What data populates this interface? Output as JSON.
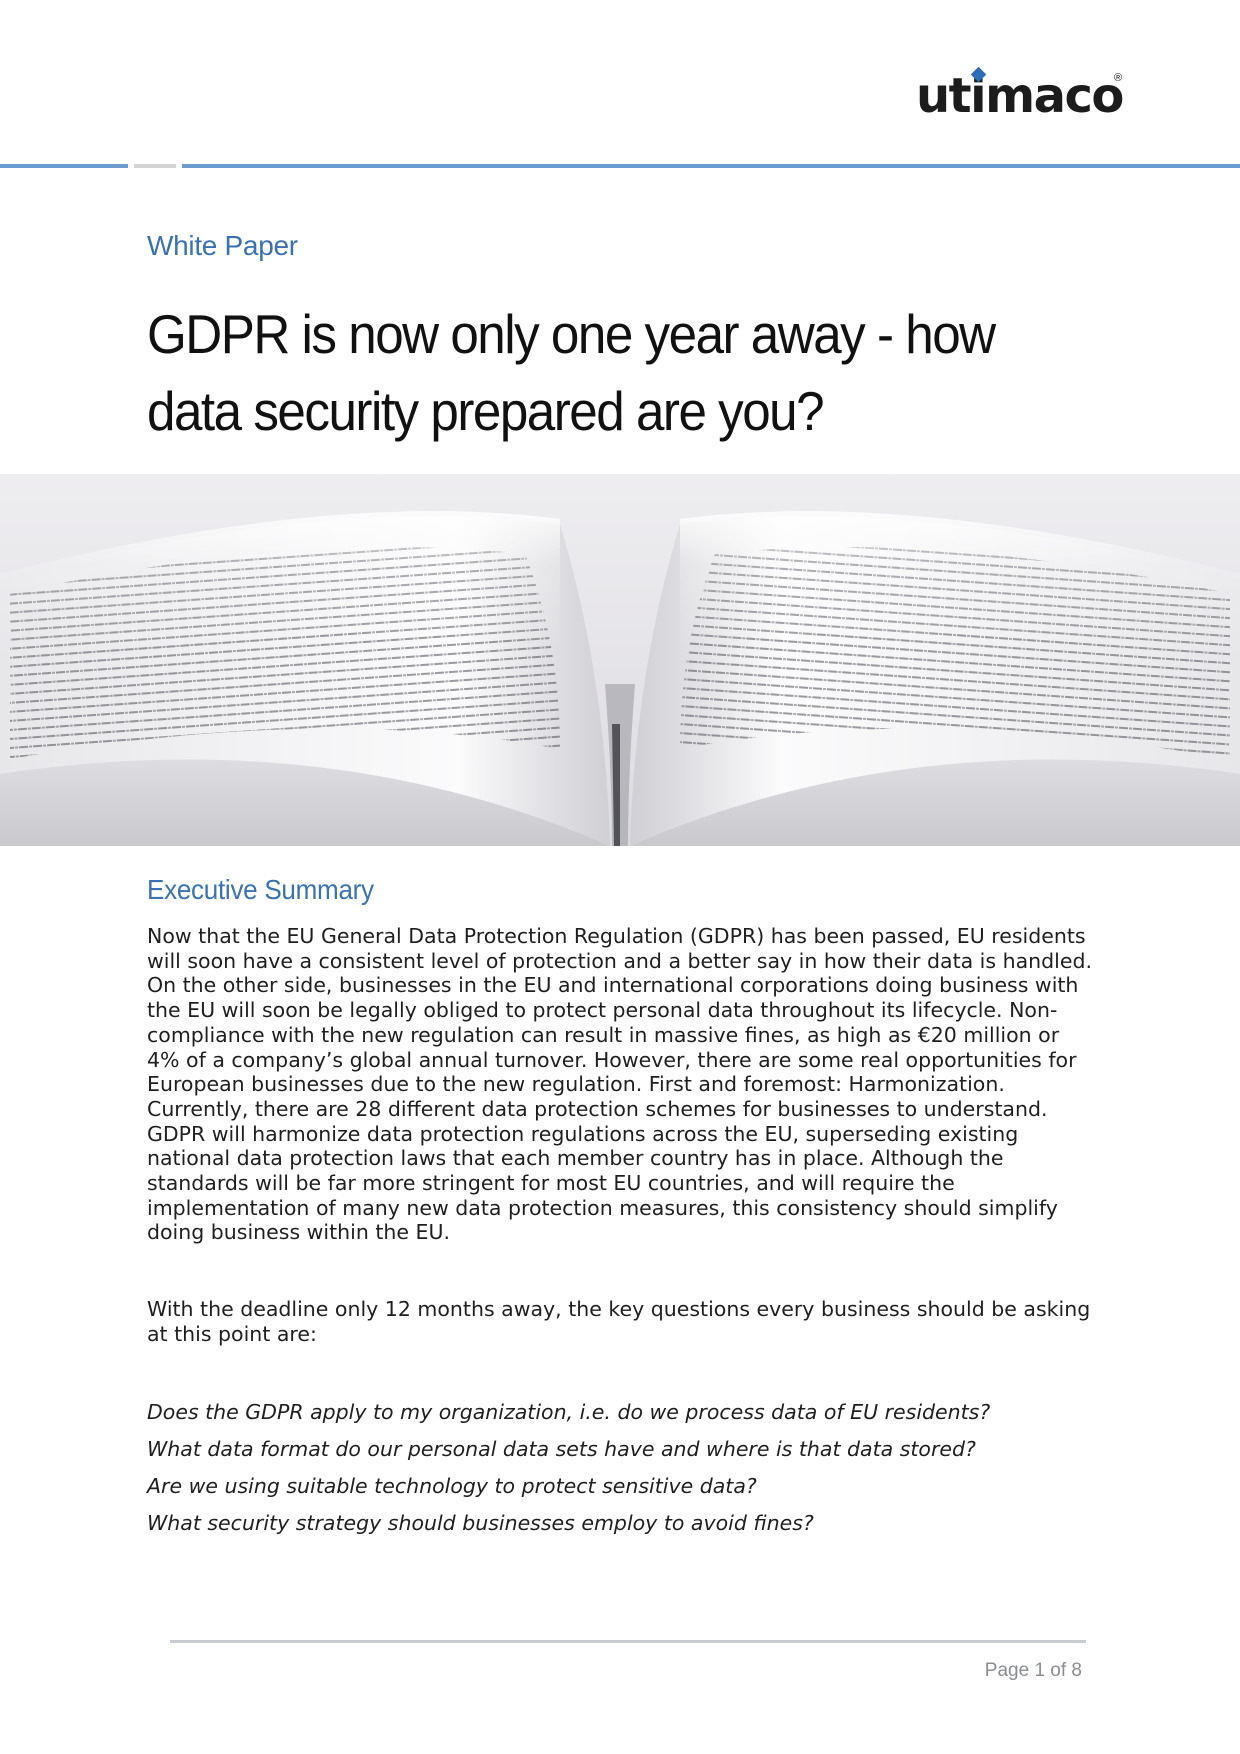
{
  "brand": {
    "logo_text": "utimaco",
    "registered_mark": "®",
    "accent_color": "#3b73b0"
  },
  "document": {
    "type_label": "White Paper",
    "title": "GDPR is now only one year away - how data security prepared are you?",
    "hero_image": "open-book-photo"
  },
  "executive_summary": {
    "heading": "Executive Summary",
    "paragraph_1": "Now that the EU General Data Protection Regulation (GDPR) has been passed, EU residents will soon have a consistent level of protection and a better say in how their data is handled. On the other side, businesses in the EU and international corporations doing business with the EU will soon be legally obliged to protect personal data throughout its lifecycle. Non-compliance with the new regulation can result in massive fines, as high as €20 million or 4% of a company’s global annual turnover. However, there are some real opportunities for European businesses due to the new regulation. First and foremost: Harmonization. Currently, there are 28 different data protection schemes for businesses to understand. GDPR will harmonize data protection regulations across the EU, superseding existing national data protection laws that each member country has in place. Although the standards will be far more stringent for most EU countries, and will require the implementation of many new data protection measures, this consistency should simplify doing business within the EU.",
    "paragraph_2": "With the deadline only 12 months away, the key questions every business should be asking at this point are:",
    "questions": [
      "Does the GDPR apply to my organization, i.e. do we process data of EU residents?",
      "What data format do our personal data sets have and where is that data stored?",
      "Are we using suitable technology to protect sensitive data?",
      "What security strategy should businesses employ to avoid fines?"
    ]
  },
  "footer": {
    "page_label": "Page 1 of 8"
  }
}
